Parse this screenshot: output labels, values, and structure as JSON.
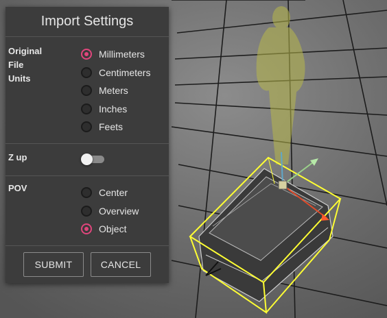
{
  "dialog": {
    "title": "Import Settings",
    "units": {
      "label_lines": [
        "Original",
        "File",
        "Units"
      ],
      "options": [
        "Millimeters",
        "Centimeters",
        "Meters",
        "Inches",
        "Feets"
      ],
      "selected": 0
    },
    "z_up": {
      "label": "Z up",
      "enabled": false
    },
    "pov": {
      "label": "POV",
      "options": [
        "Center",
        "Overview",
        "Object"
      ],
      "selected": 2
    },
    "submit_label": "SUBMIT",
    "cancel_label": "CANCEL"
  },
  "colors": {
    "accent": "#e0467c",
    "panel_bg": "#3c3c3c",
    "bounding_box": "#ffff33",
    "figure": "#b8b84a"
  }
}
